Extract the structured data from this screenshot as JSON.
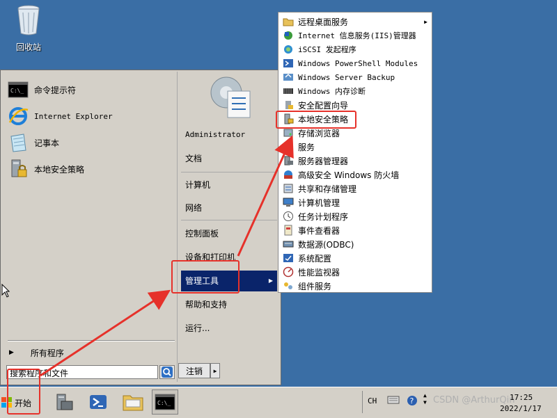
{
  "desktop": {
    "recycle_label": "回收站"
  },
  "start_menu": {
    "pinned": [
      {
        "label": "命令提示符",
        "icon": "cmd-icon"
      },
      {
        "label": "Internet Explorer",
        "icon": "ie-icon"
      },
      {
        "label": "记事本",
        "icon": "notepad-icon"
      },
      {
        "label": "本地安全策略",
        "icon": "security-policy-icon"
      }
    ],
    "all_programs": "所有程序",
    "search_placeholder": "搜索程序和文件",
    "user": "Administrator",
    "right_items": [
      "文档",
      "计算机",
      "网络",
      "控制面板",
      "设备和打印机",
      "管理工具",
      "帮助和支持",
      "运行..."
    ],
    "logoff": "注销"
  },
  "admin_tools": [
    {
      "label": "远程桌面服务",
      "icon": "folder-icon",
      "submenu": true
    },
    {
      "label": "Internet 信息服务(IIS)管理器",
      "icon": "iis-icon"
    },
    {
      "label": "iSCSI 发起程序",
      "icon": "iscsi-icon"
    },
    {
      "label": "Windows PowerShell Modules",
      "icon": "powershell-icon"
    },
    {
      "label": "Windows Server Backup",
      "icon": "backup-icon"
    },
    {
      "label": "Windows 内存诊断",
      "icon": "memory-icon"
    },
    {
      "label": "安全配置向导",
      "icon": "wizard-icon"
    },
    {
      "label": "本地安全策略",
      "icon": "security-policy-icon"
    },
    {
      "label": "存储浏览器",
      "icon": "storage-icon"
    },
    {
      "label": "服务",
      "icon": "services-icon"
    },
    {
      "label": "服务器管理器",
      "icon": "server-manager-icon"
    },
    {
      "label": "高级安全 Windows 防火墙",
      "icon": "firewall-icon"
    },
    {
      "label": "共享和存储管理",
      "icon": "share-icon"
    },
    {
      "label": "计算机管理",
      "icon": "computer-management-icon"
    },
    {
      "label": "任务计划程序",
      "icon": "clock-icon"
    },
    {
      "label": "事件查看器",
      "icon": "event-viewer-icon"
    },
    {
      "label": "数据源(ODBC)",
      "icon": "odbc-icon"
    },
    {
      "label": "系统配置",
      "icon": "msconfig-icon"
    },
    {
      "label": "性能监视器",
      "icon": "perf-icon"
    },
    {
      "label": "组件服务",
      "icon": "component-icon"
    }
  ],
  "taskbar": {
    "start_label": "开始",
    "lang": "CH",
    "time": "17:25",
    "date": "2022/1/17",
    "watermark": "CSDN @ArthurQin"
  },
  "colors": {
    "desktop": "#3a6ea5",
    "menu": "#d4d0c8",
    "selected": "#0a246a",
    "annotation": "#e6312a"
  }
}
